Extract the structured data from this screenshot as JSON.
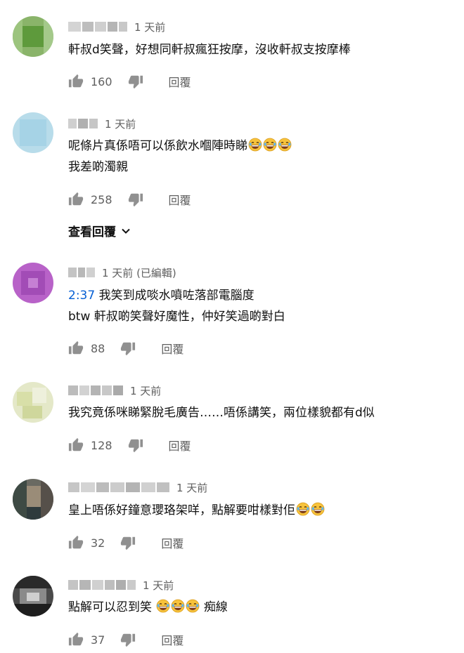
{
  "comments": [
    {
      "time": "1 天前",
      "lines": [
        "軒叔d笑聲，好想同軒叔瘋狂按摩，沒收軒叔支按摩棒"
      ],
      "likes": "160",
      "reply": "回覆"
    },
    {
      "time": "1 天前",
      "lines": [
        "呢條片真係唔可以係飲水嗰陣時睇",
        "我差啲濁親"
      ],
      "likes": "258",
      "reply": "回覆",
      "view_replies": "查看回覆"
    },
    {
      "time": "1 天前 (已編輯)",
      "timestamp_link": "2:37",
      "lines": [
        "我笑到成啖水噴咗落部電腦度",
        "btw 軒叔啲笑聲好魔性，仲好笑過啲對白"
      ],
      "likes": "88",
      "reply": "回覆"
    },
    {
      "time": "1 天前",
      "lines": [
        "我究竟係咪睇緊脫毛廣告……唔係講笑，兩位樣貌都有d似"
      ],
      "likes": "128",
      "reply": "回覆"
    },
    {
      "time": "1 天前",
      "lines": [
        "皇上唔係好鐘意瓔珞架咩，點解要咁樣對佢"
      ],
      "likes": "32",
      "reply": "回覆"
    },
    {
      "time": "1 天前",
      "lines": [
        "點解可以忍到笑",
        "痴線"
      ],
      "likes": "37",
      "reply": "回覆"
    }
  ],
  "icons": {
    "like": "thumbs-up-icon",
    "dislike": "thumbs-down-icon",
    "emoji": "tears-of-joy-emoji",
    "expand": "chevron-down-icon"
  },
  "colors": {
    "meta_text": "#606060",
    "link": "#065fd4",
    "icon": "#909090"
  }
}
